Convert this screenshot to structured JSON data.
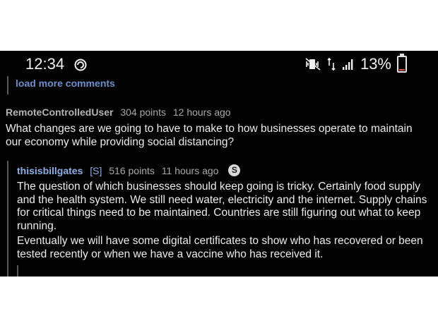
{
  "status_bar": {
    "time": "12:34",
    "battery": "13%",
    "icons": [
      "sync-icon",
      "mute-vibrate-icon",
      "data-icon",
      "signal-icon",
      "battery-icon"
    ],
    "battery_level": 0.13
  },
  "thread": {
    "load_more_label": "load more comments",
    "comments": [
      {
        "username": "RemoteControlledUser",
        "points": "304 points",
        "time": "12 hours ago",
        "body": [
          "What changes are we going to have to make to how businesses operate to maintain our economy while providing social distancing?"
        ]
      },
      {
        "username": "thisisbillgates",
        "tag": "[S]",
        "points": "516 points",
        "time": "11 hours ago",
        "badge_icon": "verified-icon",
        "body": [
          "The question of which businesses should keep going is tricky. Certainly food supply and the health system. We still need water, electricity and the internet. Supply chains for critical things need to be maintained. Countries are still figuring out what to keep running.",
          "Eventually we will have some digital certificates to show who has recovered or been tested recently or when we have a vaccine who has received it."
        ]
      }
    ]
  },
  "colors": {
    "background": "#020202",
    "link": "#6d8fcf",
    "op_username": "#8aaee6",
    "text": "#ececec",
    "meta": "#a8a8a8"
  }
}
